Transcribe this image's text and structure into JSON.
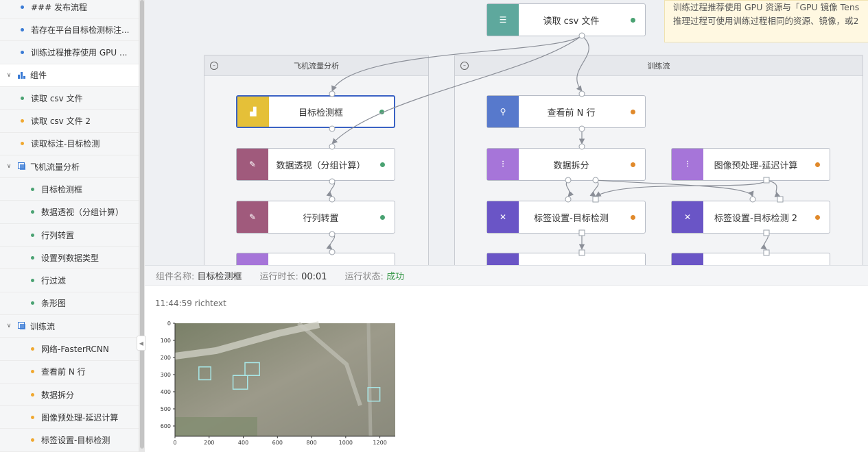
{
  "sidebar": {
    "rows": [
      {
        "kind": "item",
        "label": "### 发布流程",
        "dot": "blue",
        "indent": 30
      },
      {
        "kind": "item",
        "label": "若存在平台目标检测标注...",
        "dot": "blue",
        "indent": 30
      },
      {
        "kind": "item",
        "label": "训练过程推荐使用 GPU ...",
        "dot": "blue",
        "indent": 30
      },
      {
        "kind": "group",
        "label": "组件",
        "icon": "components-icon",
        "active": true
      },
      {
        "kind": "item",
        "label": "读取 csv 文件",
        "dot": "green",
        "indent": 30
      },
      {
        "kind": "item",
        "label": "读取 csv 文件 2",
        "dot": "orange",
        "indent": 30
      },
      {
        "kind": "item",
        "label": "读取标注-目标检测",
        "dot": "orange",
        "indent": 30
      },
      {
        "kind": "group",
        "label": "飞机流量分析",
        "icon": "group-icon"
      },
      {
        "kind": "item",
        "label": "目标检测框",
        "dot": "green",
        "indent": 45
      },
      {
        "kind": "item",
        "label": "数据透视（分组计算）",
        "dot": "green",
        "indent": 45
      },
      {
        "kind": "item",
        "label": "行列转置",
        "dot": "green",
        "indent": 45
      },
      {
        "kind": "item",
        "label": "设置列数据类型",
        "dot": "green",
        "indent": 45
      },
      {
        "kind": "item",
        "label": "行过滤",
        "dot": "green",
        "indent": 45
      },
      {
        "kind": "item",
        "label": "条形图",
        "dot": "green",
        "indent": 45
      },
      {
        "kind": "group",
        "label": "训练流",
        "icon": "group-icon"
      },
      {
        "kind": "item",
        "label": "网络-FasterRCNN",
        "dot": "orange",
        "indent": 45
      },
      {
        "kind": "item",
        "label": "查看前 N 行",
        "dot": "orange",
        "indent": 45
      },
      {
        "kind": "item",
        "label": "数据拆分",
        "dot": "orange",
        "indent": 45
      },
      {
        "kind": "item",
        "label": "图像预处理-延迟计算",
        "dot": "orange",
        "indent": 45
      },
      {
        "kind": "item",
        "label": "标签设置-目标检测",
        "dot": "orange",
        "indent": 45
      }
    ]
  },
  "canvas": {
    "note_lines": [
      "训练过程推荐使用 GPU 资源与「GPU 镜像 Tens",
      "推理过程可使用训练过程相同的资源、镜像，或2"
    ],
    "containers": {
      "flight": {
        "title": "飞机流量分析"
      },
      "train": {
        "title": "训练流"
      }
    },
    "nodes": {
      "read_csv": {
        "label": "读取 csv 文件",
        "icon": "database-icon",
        "color": "#5ea89d",
        "status": "green"
      },
      "detect_box": {
        "label": "目标检测框",
        "icon": "chart-icon",
        "color": "#e5c038",
        "status": "green"
      },
      "pivot": {
        "label": "数据透视（分组计算）",
        "icon": "wrench-icon",
        "color": "#a05a7c",
        "status": "green"
      },
      "transpose": {
        "label": "行列转置",
        "icon": "wrench-icon",
        "color": "#a05a7c",
        "status": "green"
      },
      "head_n": {
        "label": "查看前 N 行",
        "icon": "search-icon",
        "color": "#5779cc",
        "status": "orange"
      },
      "split": {
        "label": "数据拆分",
        "icon": "split-icon",
        "color": "#a675d9",
        "status": "orange"
      },
      "preprocess": {
        "label": "图像预处理-延迟计算",
        "icon": "split-icon",
        "color": "#a675d9",
        "status": "orange"
      },
      "label_set": {
        "label": "标签设置-目标检测",
        "icon": "tag-icon",
        "color": "#6a55c6",
        "status": "orange"
      },
      "label_set2": {
        "label": "标签设置-目标检测 2",
        "icon": "tag-icon",
        "color": "#6a55c6",
        "status": "orange"
      }
    }
  },
  "info_bar": {
    "name_label": "组件名称:",
    "name_value": "目标检测框",
    "duration_label": "运行时长:",
    "duration_value": "00:01",
    "status_label": "运行状态:",
    "status_value": "成功"
  },
  "output": {
    "log_line": "11:44:59 richtext"
  },
  "chart_data": {
    "type": "scatter",
    "title": "",
    "xlabel": "",
    "ylabel": "",
    "x_ticks": [
      0,
      200,
      400,
      600,
      800,
      1000,
      1200
    ],
    "y_ticks": [
      0,
      100,
      200,
      300,
      400,
      500,
      600
    ],
    "xlim": [
      0,
      1290
    ],
    "ylim": [
      660,
      0
    ],
    "image_caption": "aerial airport image with detection boxes",
    "boxes": [
      {
        "x0": 140,
        "y0": 255,
        "x1": 210,
        "y1": 330
      },
      {
        "x0": 410,
        "y0": 230,
        "x1": 495,
        "y1": 305
      },
      {
        "x0": 340,
        "y0": 305,
        "x1": 425,
        "y1": 385
      },
      {
        "x0": 1130,
        "y0": 375,
        "x1": 1200,
        "y1": 455
      }
    ]
  }
}
